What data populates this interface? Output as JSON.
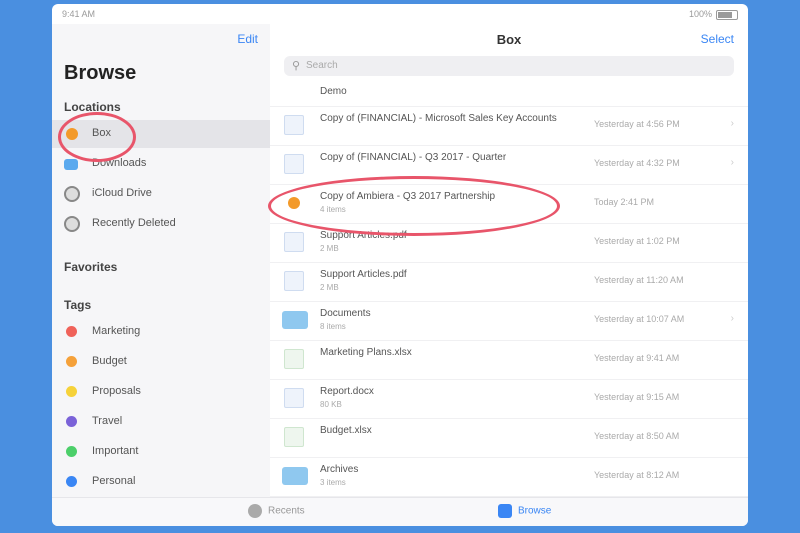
{
  "status": {
    "time": "9:41 AM",
    "signal": "100%"
  },
  "sidebar": {
    "edit_label": "Edit",
    "title": "Browse",
    "locations_header": "Locations",
    "locations": [
      {
        "label": "Box",
        "icon": "box-icon",
        "color": "#f39a2a"
      },
      {
        "label": "Downloads",
        "icon": "folder-icon",
        "color": "#5aa9ee"
      },
      {
        "label": "iCloud Drive",
        "icon": "cloud-icon",
        "color": "#888888"
      },
      {
        "label": "Recently Deleted",
        "icon": "trash-icon",
        "color": "#888888"
      }
    ],
    "favorites_header": "Favorites",
    "tags_header": "Tags",
    "tags": [
      {
        "label": "Marketing",
        "color": "#f0625a"
      },
      {
        "label": "Budget",
        "color": "#f5a13a"
      },
      {
        "label": "Proposals",
        "color": "#f6d23a"
      },
      {
        "label": "Travel",
        "color": "#7a62d8"
      },
      {
        "label": "Important",
        "color": "#4ccf6a"
      },
      {
        "label": "Personal",
        "color": "#3a86f4"
      }
    ]
  },
  "main": {
    "title": "Box",
    "select_label": "Select",
    "search_placeholder": "Search",
    "files": [
      {
        "name": "Demo",
        "sub": "",
        "date": "",
        "icon": "doc-icon",
        "kind": "doc"
      },
      {
        "name": "Copy of (FINANCIAL) - Microsoft Sales Key Accounts",
        "sub": "",
        "date": "Yesterday at 4:56 PM",
        "icon": "doc-icon",
        "kind": "doc"
      },
      {
        "name": "Copy of (FINANCIAL) - Q3 2017 - Quarter",
        "sub": "",
        "date": "Yesterday at 4:32 PM",
        "icon": "doc-icon",
        "kind": "doc"
      },
      {
        "name": "Copy of Ambiera - Q3 2017 Partnership",
        "sub": "4 items",
        "date": "Today 2:41 PM",
        "icon": "box-icon",
        "kind": "orange"
      },
      {
        "name": "Support Articles.pdf",
        "sub": "2 MB",
        "date": "Yesterday at 1:02 PM",
        "icon": "doc-icon",
        "kind": "doc"
      },
      {
        "name": "Support Articles.pdf",
        "sub": "2 MB",
        "date": "Yesterday at 11:20 AM",
        "icon": "doc-icon",
        "kind": "doc"
      },
      {
        "name": "Documents",
        "sub": "8 items",
        "date": "Yesterday at 10:07 AM",
        "icon": "folder-icon",
        "kind": "folder"
      },
      {
        "name": "Marketing Plans.xlsx",
        "sub": "",
        "date": "Yesterday at 9:41 AM",
        "icon": "spreadsheet-icon",
        "kind": "green"
      },
      {
        "name": "Report.docx",
        "sub": "80 KB",
        "date": "Yesterday at 9:15 AM",
        "icon": "doc-icon",
        "kind": "doc"
      },
      {
        "name": "Budget.xlsx",
        "sub": "",
        "date": "Yesterday at 8:50 AM",
        "icon": "spreadsheet-icon",
        "kind": "green"
      },
      {
        "name": "Archives",
        "sub": "3 items",
        "date": "Yesterday at 8:12 AM",
        "icon": "folder-icon",
        "kind": "folder"
      }
    ]
  },
  "tabbar": {
    "recents_label": "Recents",
    "browse_label": "Browse"
  }
}
